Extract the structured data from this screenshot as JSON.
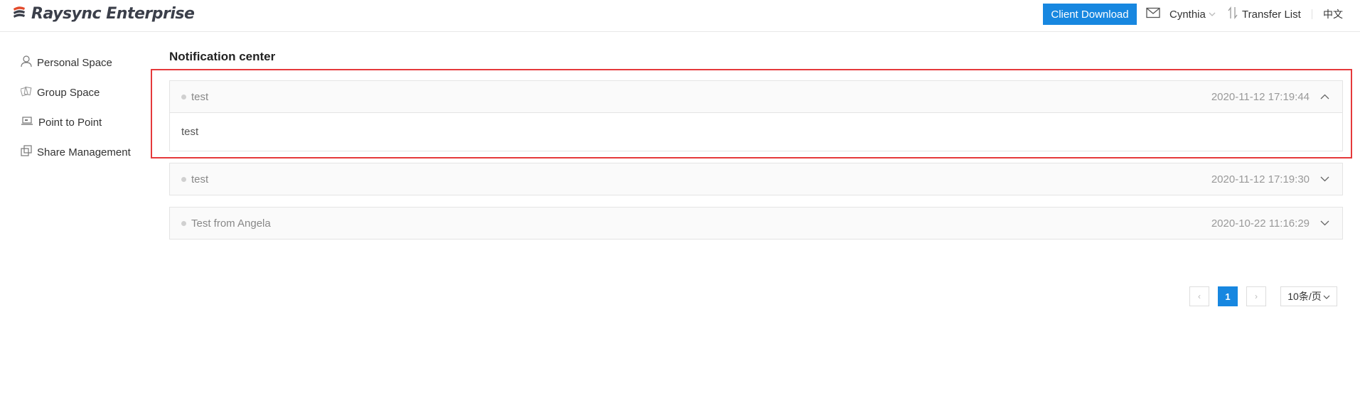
{
  "header": {
    "brand": "Raysync Enterprise",
    "download_button": "Client Download",
    "user_name": "Cynthia",
    "transfer_list": "Transfer List",
    "language": "中文"
  },
  "sidebar": {
    "items": [
      {
        "label": "Personal Space",
        "icon": "user-icon"
      },
      {
        "label": "Group Space",
        "icon": "group-icon"
      },
      {
        "label": "Point to Point",
        "icon": "laptop-icon"
      },
      {
        "label": "Share Management",
        "icon": "share-icon"
      }
    ]
  },
  "main": {
    "title": "Notification center",
    "notifications": [
      {
        "title": "test",
        "time": "2020-11-12 17:19:44",
        "expanded": true,
        "body": "test"
      },
      {
        "title": "test",
        "time": "2020-11-12 17:19:30",
        "expanded": false
      },
      {
        "title": "Test from Angela",
        "time": "2020-10-22 11:16:29",
        "expanded": false
      }
    ]
  },
  "pagination": {
    "prev": "‹",
    "current_page": "1",
    "next": "›",
    "page_size": "10条/页"
  },
  "colors": {
    "accent": "#1787e0",
    "highlight_border": "#e5393b"
  }
}
